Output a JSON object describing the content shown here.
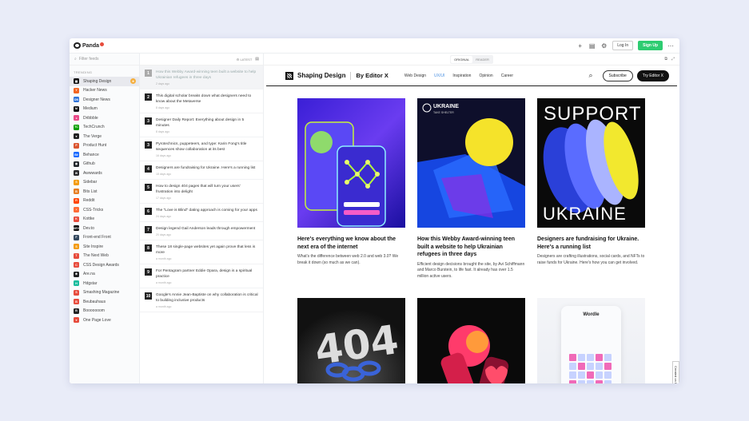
{
  "app": {
    "name": "Panda",
    "login": "Log In",
    "signup": "Sign Up"
  },
  "sidebar": {
    "filter_placeholder": "Filter feeds",
    "section": "TRENDING",
    "items": [
      {
        "label": "Shaping Design",
        "color": "#111111",
        "glyph": "▦",
        "active": true
      },
      {
        "label": "Hacker News",
        "color": "#f26522",
        "glyph": "Y"
      },
      {
        "label": "Designer News",
        "color": "#2d72d9",
        "glyph": "DN"
      },
      {
        "label": "Medium",
        "color": "#111111",
        "glyph": "M"
      },
      {
        "label": "Dribbble",
        "color": "#ea4c89",
        "glyph": "●"
      },
      {
        "label": "TechCrunch",
        "color": "#0a9e01",
        "glyph": "TC"
      },
      {
        "label": "The Verge",
        "color": "#222222",
        "glyph": "▼"
      },
      {
        "label": "Product Hunt",
        "color": "#da552f",
        "glyph": "P"
      },
      {
        "label": "Behance",
        "color": "#1769ff",
        "glyph": "Bē"
      },
      {
        "label": "Github",
        "color": "#24292e",
        "glyph": "◉"
      },
      {
        "label": "Awwwards",
        "color": "#2b2b2b",
        "glyph": "W"
      },
      {
        "label": "Sidebar",
        "color": "#f39c12",
        "glyph": "S"
      },
      {
        "label": "Bits List",
        "color": "#e67e22",
        "glyph": "B"
      },
      {
        "label": "Reddit",
        "color": "#ff4500",
        "glyph": "R"
      },
      {
        "label": "CSS-Tricks",
        "color": "#ff6b35",
        "glyph": "*"
      },
      {
        "label": "Kottke",
        "color": "#e74c3c",
        "glyph": "K"
      },
      {
        "label": "Dev.to",
        "color": "#0a0a0a",
        "glyph": "DEV"
      },
      {
        "label": "Front-end Front",
        "color": "#34495e",
        "glyph": "F"
      },
      {
        "label": "Site Inspire",
        "color": "#f39c12",
        "glyph": "S"
      },
      {
        "label": "The Next Web",
        "color": "#e74c3c",
        "glyph": "T"
      },
      {
        "label": "CSS Design Awards",
        "color": "#e84c3d",
        "glyph": "C"
      },
      {
        "label": "Are.na",
        "color": "#222222",
        "glyph": "✱"
      },
      {
        "label": "Hdgstar",
        "color": "#1abc9c",
        "glyph": "H"
      },
      {
        "label": "Smashing Magazine",
        "color": "#e74c3c",
        "glyph": "S"
      },
      {
        "label": "Beubauhaus",
        "color": "#e74c3c",
        "glyph": "B"
      },
      {
        "label": "Booooooom",
        "color": "#222222",
        "glyph": "B"
      },
      {
        "label": "One Page Love",
        "color": "#e74c3c",
        "glyph": "♥"
      }
    ]
  },
  "list": {
    "filter": "LATEST",
    "items": [
      {
        "n": "1",
        "title": "How this Webby Award-winning teen built a website to help Ukrainian refugees in three days",
        "ago": "2 days ago",
        "selected": true
      },
      {
        "n": "2",
        "title": "This digital scholar breaks down what designers need to know about the Metaverse",
        "ago": "8 days ago"
      },
      {
        "n": "3",
        "title": "Designer Daily Report: Everything about design in 5 minutes",
        "ago": "8 days ago"
      },
      {
        "n": "3",
        "title": "Pyrotechnics, puppeteers, and type: Karin Fong's title sequences show collaboration at its best",
        "ago": "16 days ago"
      },
      {
        "n": "4",
        "title": "Designers are fundraising for Ukraine. Here's a running list",
        "ago": "18 days ago"
      },
      {
        "n": "5",
        "title": "How to design 404 pages that will turn your users' frustration into delight",
        "ago": "17 days ago"
      },
      {
        "n": "6",
        "title": "The \"Love is Blind\" dating approach is coming for your apps",
        "ago": "24 days ago"
      },
      {
        "n": "7",
        "title": "Design legend Gail Anderson leads through empowerment",
        "ago": "20 days ago"
      },
      {
        "n": "8",
        "title": "These 18 single-page websites yet again prove that less is more",
        "ago": "a month ago"
      },
      {
        "n": "9",
        "title": "For Pentagram partner Eddie Opara, design is a spiritual practice",
        "ago": "a month ago"
      },
      {
        "n": "10",
        "title": "Google's Annie Jean-Baptiste on why collaboration is critical to building inclusive products",
        "ago": "a month ago"
      }
    ]
  },
  "reader": {
    "mode_original": "ORIGINAL",
    "mode_reader": "READER",
    "site_name": "Shaping Design",
    "by": "By Editor X",
    "nav": [
      "Web Design",
      "UX/UI",
      "Inspiration",
      "Opinion",
      "Career"
    ],
    "nav_active": 1,
    "subscribe": "Subscribe",
    "try": "Try Editor X",
    "cards": [
      {
        "title": "Here's everything we know about the next era of the internet",
        "desc": "What's the difference between web 2.0 and web 3.0? We break it down (so much as we can)."
      },
      {
        "title": "How this Webby Award-winning teen built a website to help Ukrainian refugees in three days",
        "desc": "Efficient design decisions brought the site, by Avi Schiffmann and Marco Burstein, to life fast. It already has over 1.5 million active users.",
        "art_label": "UKRAINE",
        "art_sub": "TAKE SHELTER"
      },
      {
        "title": "Designers are fundraising for Ukraine. Here's a running list",
        "desc": "Designers are crafting illustrations, social cards, and NFTs to raise funds for Ukraine. Here's how you can get involved.",
        "art_top": "SUPPORT",
        "art_bottom": "UKRAINE"
      },
      {
        "art_label": "404"
      },
      {},
      {
        "art_label": "Wordle"
      }
    ],
    "created_on": "Created on Editor X"
  }
}
